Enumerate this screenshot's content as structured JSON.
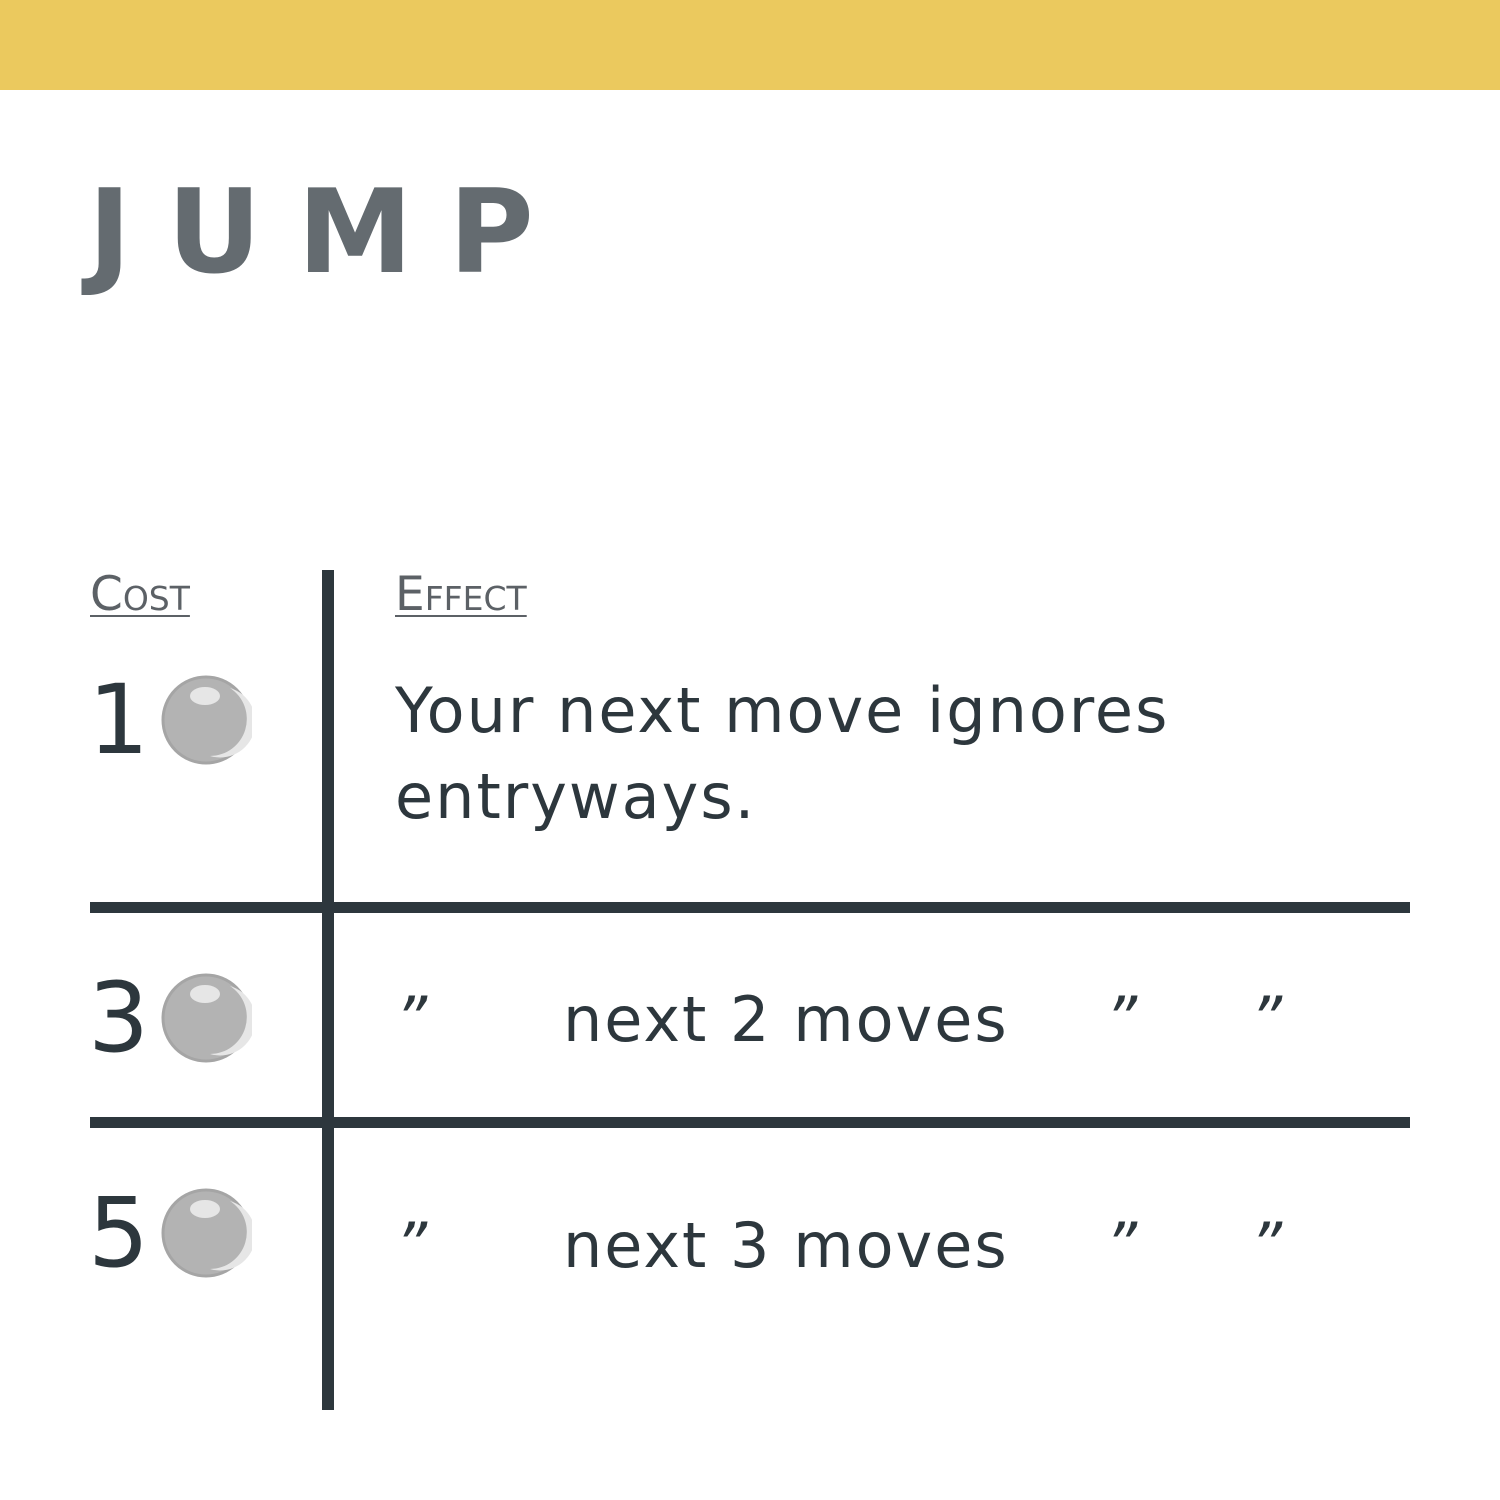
{
  "colors": {
    "top_bar": "#ebc95e",
    "title": "#646b70",
    "text": "#2d373d",
    "header": "#5c6166",
    "divider": "#2d373d",
    "orb_fill": "#b3b3b3",
    "orb_stroke": "#a5a5a5",
    "orb_highlight": "#e6e6e6"
  },
  "card": {
    "title": "JUMP"
  },
  "table": {
    "cost_header": "Cost",
    "effect_header": "Effect",
    "rows": [
      {
        "cost": "1",
        "icon": "orb-icon",
        "effect": "Your next move ignores entryways."
      },
      {
        "cost": "3",
        "icon": "orb-icon",
        "ditto_mark": "”",
        "effect": "next 2 moves"
      },
      {
        "cost": "5",
        "icon": "orb-icon",
        "ditto_mark": "”",
        "effect": "next 3 moves"
      }
    ]
  }
}
